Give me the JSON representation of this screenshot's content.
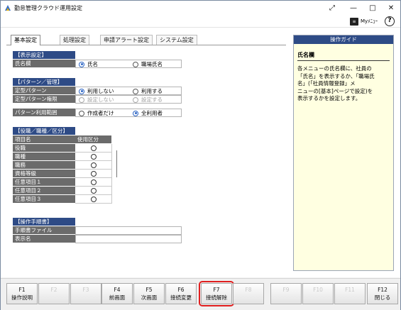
{
  "window": {
    "title": "勤怠管理クラウド運用設定"
  },
  "titlebar": {
    "expand_glyph": "⤢",
    "min_glyph": "—",
    "max_glyph": "□",
    "close_glyph": "✕"
  },
  "topstrip": {
    "mymenu_label": "Myﾒﾆｭｰ",
    "help_label": "?"
  },
  "tabs": [
    {
      "label": "基本設定",
      "active": true
    },
    {
      "label": "処理設定",
      "active": false
    },
    {
      "label": "申請アラート設定",
      "active": false
    },
    {
      "label": "システム設定",
      "active": false
    }
  ],
  "display": {
    "title": "【表示設定】",
    "name_label": "氏名欄",
    "opt_name": "氏名",
    "opt_job_name": "職場氏名"
  },
  "pattern": {
    "title": "【パターン／管理】",
    "fixed_label": "定型パターン",
    "fixed_off": "利用しない",
    "fixed_on": "利用する",
    "auth_label": "定型パターン権限",
    "auth_off": "設定しない",
    "auth_on": "設定する",
    "scope_label": "パターン利用範囲",
    "scope_creator": "作成者だけ",
    "scope_all": "全利用者"
  },
  "grade": {
    "title": "【役職／職種／区分】",
    "col_name": "項目名",
    "col_use": "使用区分",
    "rows": [
      "役職",
      "職種",
      "職務",
      "資格等級",
      "任意項目１",
      "任意項目２",
      "任意項目３"
    ]
  },
  "procedure": {
    "title": "【操作手順書】",
    "file_label": "手順書ファイル",
    "display_label": "表示名"
  },
  "guide": {
    "header": "操作ガイド",
    "title": "氏名欄",
    "body": "各メニューの氏名欄に、社員の\n「氏名」を表示するか、「職場氏\n名」(「社員情報登録」メ\nニューの[基本]ページで設定)を\n表示するかを設定します。"
  },
  "fkeys": [
    {
      "key": "F1",
      "label": "操作説明",
      "enabled": true
    },
    {
      "key": "F2",
      "label": "",
      "enabled": false
    },
    {
      "key": "F3",
      "label": "",
      "enabled": false
    },
    {
      "key": "F4",
      "label": "前画面",
      "enabled": true
    },
    {
      "key": "F5",
      "label": "次画面",
      "enabled": true
    },
    {
      "key": "F6",
      "label": "接続変更",
      "enabled": true
    },
    {
      "key": "F7",
      "label": "接続解除",
      "enabled": true,
      "highlighted": true
    },
    {
      "key": "F8",
      "label": "",
      "enabled": false
    },
    {
      "key": "F9",
      "label": "",
      "enabled": false
    },
    {
      "key": "F10",
      "label": "",
      "enabled": false
    },
    {
      "key": "F11",
      "label": "",
      "enabled": false
    },
    {
      "key": "F12",
      "label": "閉じる",
      "enabled": true
    }
  ],
  "colors": {
    "section": "#2e4b86",
    "label_bg": "#6b6b6b",
    "guide_bg": "#ffffe1",
    "highlight": "#e01e1e"
  }
}
